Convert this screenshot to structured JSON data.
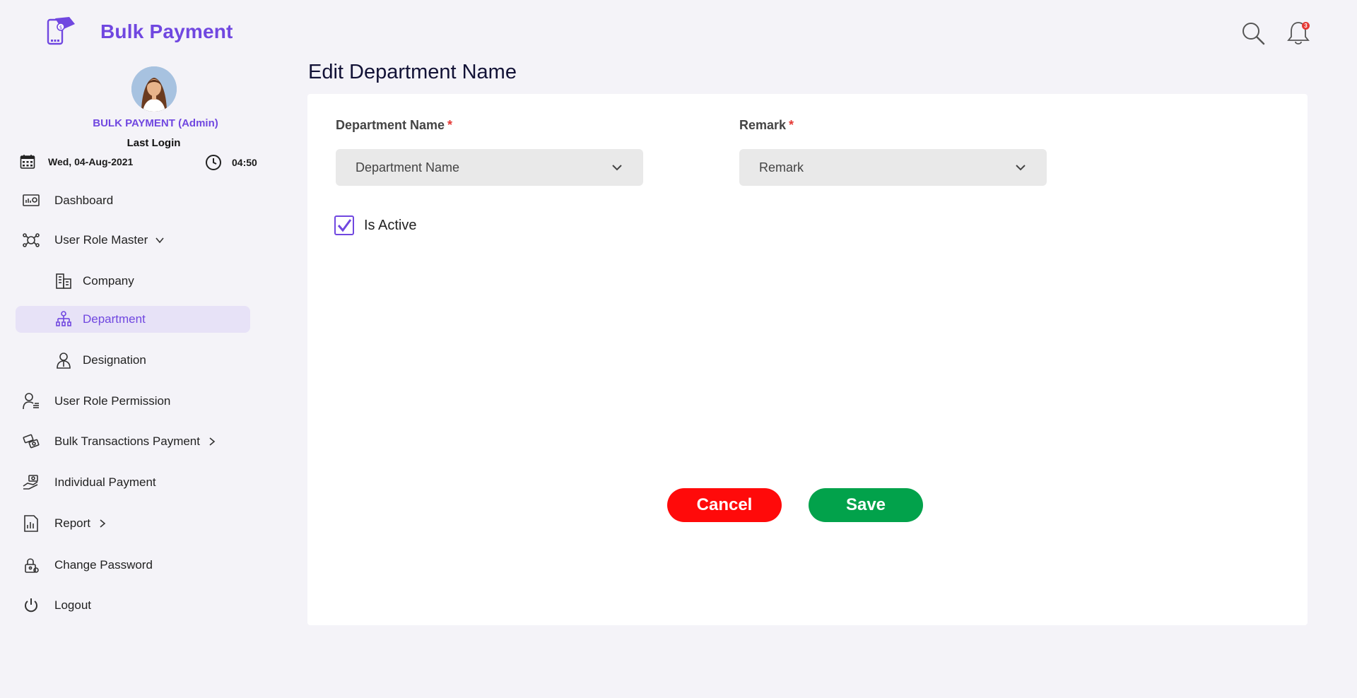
{
  "brand": {
    "name": "Bulk Payment",
    "logo_icon": "wallet-phone-icon",
    "accent": "#7047e0"
  },
  "header": {
    "notification_count": "3"
  },
  "profile": {
    "name": "BULK PAYMENT (Admin)",
    "last_login_label": "Last Login",
    "date": "Wed, 04-Aug-2021",
    "time": "04:50"
  },
  "sidebar": {
    "items": [
      {
        "label": "Dashboard",
        "icon": "dashboard-icon"
      },
      {
        "label": "User Role Master",
        "icon": "user-role-icon",
        "expanded": true
      },
      {
        "label": "Company",
        "icon": "building-icon"
      },
      {
        "label": "Department",
        "icon": "org-chart-icon",
        "active": true
      },
      {
        "label": "Designation",
        "icon": "employee-icon"
      },
      {
        "label": "User Role Permission",
        "icon": "user-list-icon"
      },
      {
        "label": "Bulk Transactions Payment",
        "icon": "transaction-icon"
      },
      {
        "label": "Individual Payment",
        "icon": "hand-payment-icon"
      },
      {
        "label": "Report",
        "icon": "report-icon"
      },
      {
        "label": "Change Password",
        "icon": "lock-icon"
      },
      {
        "label": "Logout",
        "icon": "power-icon"
      }
    ]
  },
  "main": {
    "title": "Edit Department Name",
    "department_field": {
      "label": "Department Name",
      "required_mark": "*",
      "value": "Department Name"
    },
    "remark_field": {
      "label": "Remark",
      "required_mark": "*",
      "value": "Remark"
    },
    "is_active": {
      "label": "Is Active",
      "checked": true
    },
    "cancel_label": "Cancel",
    "save_label": "Save"
  },
  "colors": {
    "cancel": "#ff0a0a",
    "save": "#02a24b",
    "required": "#e53935",
    "active_bg": "#e7e2f7"
  }
}
